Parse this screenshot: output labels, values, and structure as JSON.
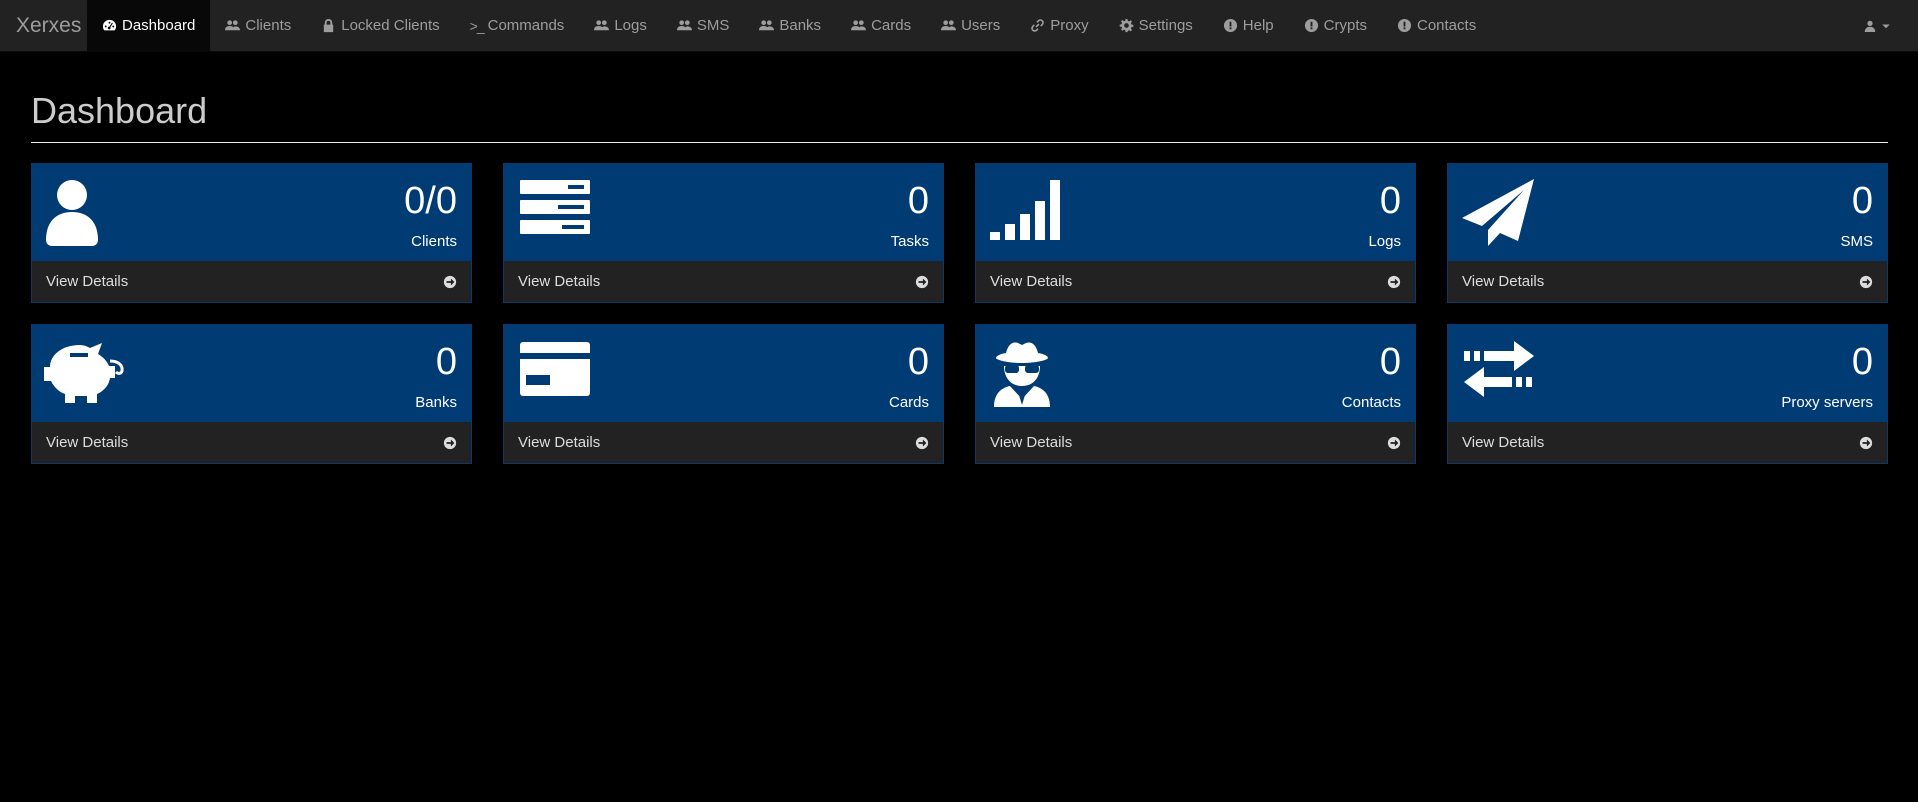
{
  "brand": "Xerxes",
  "nav": [
    {
      "label": "Dashboard",
      "icon": "dashboard-icon"
    },
    {
      "label": "Clients",
      "icon": "users-icon"
    },
    {
      "label": "Locked Clients",
      "icon": "lock-icon"
    },
    {
      "label": "Commands",
      "icon": "terminal-icon"
    },
    {
      "label": "Logs",
      "icon": "users-icon"
    },
    {
      "label": "SMS",
      "icon": "users-icon"
    },
    {
      "label": "Banks",
      "icon": "users-icon"
    },
    {
      "label": "Cards",
      "icon": "users-icon"
    },
    {
      "label": "Users",
      "icon": "users-icon"
    },
    {
      "label": "Proxy",
      "icon": "link-icon"
    },
    {
      "label": "Settings",
      "icon": "gear-icon"
    },
    {
      "label": "Help",
      "icon": "exclamation-icon"
    },
    {
      "label": "Crypts",
      "icon": "exclamation-icon"
    },
    {
      "label": "Contacts",
      "icon": "exclamation-icon"
    }
  ],
  "user_menu": {
    "icon": "user-icon",
    "caret": "caret-down-icon"
  },
  "page": {
    "title": "Dashboard"
  },
  "panels": [
    {
      "value": "0/0",
      "label": "Clients",
      "icon": "user-icon",
      "footer": "View Details"
    },
    {
      "value": "0",
      "label": "Tasks",
      "icon": "server-icon",
      "footer": "View Details"
    },
    {
      "value": "0",
      "label": "Logs",
      "icon": "signal-icon",
      "footer": "View Details"
    },
    {
      "value": "0",
      "label": "SMS",
      "icon": "paper-plane-icon",
      "footer": "View Details"
    },
    {
      "value": "0",
      "label": "Banks",
      "icon": "piggy-bank-icon",
      "footer": "View Details"
    },
    {
      "value": "0",
      "label": "Cards",
      "icon": "credit-card-icon",
      "footer": "View Details"
    },
    {
      "value": "0",
      "label": "Contacts",
      "icon": "user-secret-icon",
      "footer": "View Details"
    },
    {
      "value": "0",
      "label": "Proxy servers",
      "icon": "exchange-icon",
      "footer": "View Details"
    }
  ],
  "colors": {
    "panel_heading": "#003b73",
    "navbar": "#222222",
    "background": "#000000"
  }
}
